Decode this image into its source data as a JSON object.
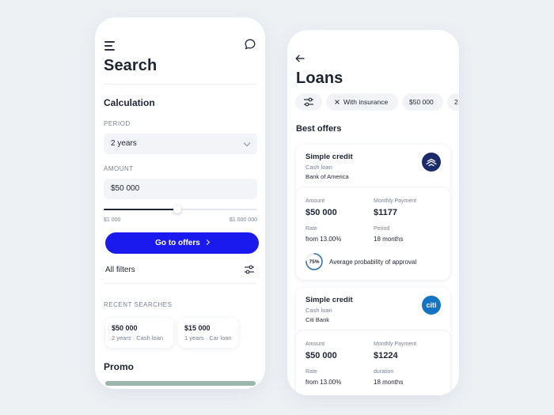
{
  "left": {
    "title": "Search",
    "calculation_title": "Calculation",
    "period": {
      "label": "PERIOD",
      "value": "2 years"
    },
    "amount": {
      "label": "AMOUNT",
      "value": "$50 000",
      "min": "$1 000",
      "max": "$1 000 000",
      "slider_fraction": 0.48
    },
    "cta_label": "Go to offers",
    "all_filters_label": "All filters",
    "recent_title": "RECENT SEARCHES",
    "recent": [
      {
        "amount": "$50 000",
        "details": "2 years · Cash loan"
      },
      {
        "amount": "$15 000",
        "details": "1 years · Car loan"
      }
    ],
    "promo_title": "Promo"
  },
  "right": {
    "title": "Loans",
    "chips": [
      {
        "label": "With insurance",
        "removable": true
      },
      {
        "label": "$50 000",
        "removable": false
      },
      {
        "label": "2",
        "removable": false
      }
    ],
    "best_offers_title": "Best offers",
    "offers": [
      {
        "title": "Simple credit",
        "type": "Cash loan",
        "bank": "Bank of America",
        "logo_color": "#1b2a6b",
        "logo_text": "",
        "amount_label": "Amount",
        "amount": "$50 000",
        "payment_label": "Monthly Payment",
        "payment": "$1177",
        "rate_label": "Rate",
        "rate": "from 13.00%",
        "term_label": "Period",
        "term": "18 months",
        "probability": "75%",
        "probability_fraction": 0.75,
        "probability_text": "Average probability of approval"
      },
      {
        "title": "Simple credit",
        "type": "Cash loan",
        "bank": "Citi Bank",
        "logo_color": "#1474c4",
        "logo_text": "citi",
        "amount_label": "Amount",
        "amount": "$50 000",
        "payment_label": "Monthly Payment",
        "payment": "$1224",
        "rate_label": "Rate",
        "rate": "from 13.00%",
        "term_label": "duration",
        "term": "18 months"
      }
    ]
  },
  "colors": {
    "accent": "#1a1aee",
    "text": "#1f2433",
    "muted": "#7a8194",
    "field_bg": "#f2f4f7",
    "ring": "#2f6fa8"
  },
  "icons": [
    "menu-icon",
    "chat-bubble-icon",
    "chevron-down-icon",
    "chevron-right-icon",
    "filter-sliders-icon",
    "back-arrow-icon",
    "close-icon"
  ]
}
